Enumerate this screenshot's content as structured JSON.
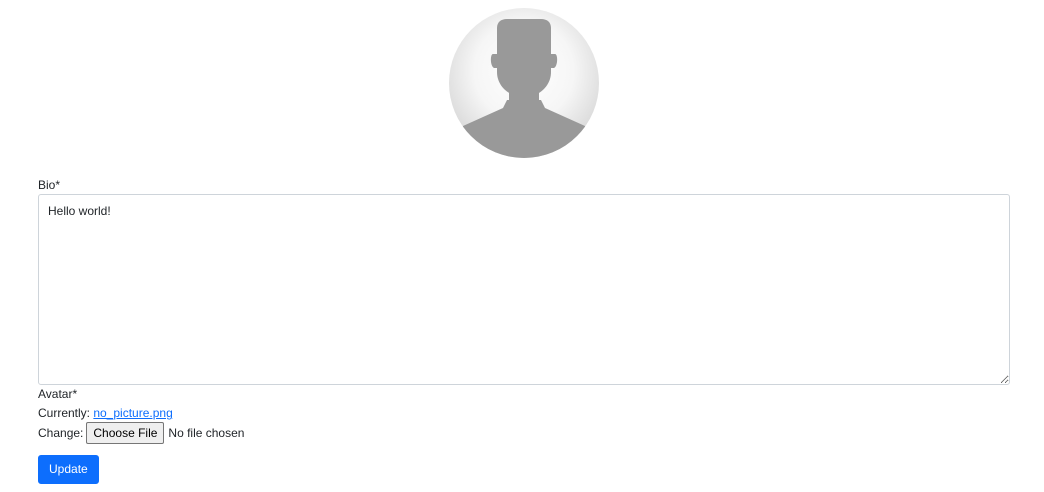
{
  "profile": {
    "avatar_icon": "default-user-silhouette-icon"
  },
  "form": {
    "bio_label": "Bio*",
    "bio_value": "Hello world!",
    "avatar_label": "Avatar*",
    "currently_label": "Currently:",
    "current_file": "no_picture.png",
    "change_label": "Change:",
    "choose_file_button": "Choose File",
    "no_file_text": "No file chosen",
    "submit_label": "Update"
  },
  "colors": {
    "primary": "#0d6efd",
    "link": "#0d6efd",
    "silhouette": "#999999"
  }
}
